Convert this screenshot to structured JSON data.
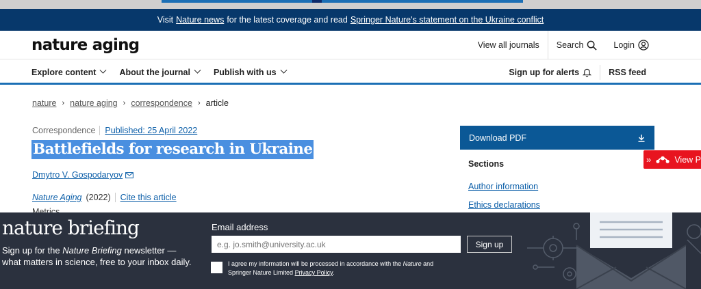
{
  "banner": {
    "prefix": "Visit",
    "link1": "Nature news",
    "middle": "for the latest coverage and read",
    "link2": "Springer Nature's statement on the Ukraine conflict"
  },
  "header": {
    "logo": "nature aging",
    "view_all": "View all journals",
    "search": "Search",
    "login": "Login"
  },
  "nav": {
    "items": [
      "Explore content",
      "About the journal",
      "Publish with us"
    ],
    "alerts": "Sign up for alerts",
    "rss": "RSS feed"
  },
  "breadcrumb": [
    "nature",
    "nature aging",
    "correspondence",
    "article"
  ],
  "article": {
    "type": "Correspondence",
    "published": "Published: 25 April 2022",
    "title": "Battlefields for research in Ukraine",
    "author": "Dmytro V. Gospodaryov",
    "journal": "Nature Aging",
    "year": "(2022)",
    "cite": "Cite this article",
    "metrics": "Metrics"
  },
  "sidebar": {
    "download": "Download PDF",
    "sections_title": "Sections",
    "sections": [
      "Author information",
      "Ethics declarations"
    ],
    "mendeley": "View P"
  },
  "briefing": {
    "logo": "nature briefing",
    "desc_pre": "Sign up for the",
    "desc_em": "Nature Briefing",
    "desc_post": "newsletter — what matters in science, free to your inbox daily.",
    "email_label": "Email address",
    "email_placeholder": "e.g. jo.smith@university.ac.uk",
    "signup": "Sign up",
    "agree_pre": "I agree my information will be processed in accordance with the",
    "agree_em": "Nature",
    "agree_mid": "and Springer Nature Limited",
    "agree_link": "Privacy Policy",
    "agree_end": "."
  },
  "colors": {
    "banner": "#07386b",
    "accent": "#1b6fb5",
    "pdf": "#0b5896",
    "mendeley": "#e8141f",
    "briefing": "#2b313e",
    "highlight": "#4a8fe0"
  }
}
